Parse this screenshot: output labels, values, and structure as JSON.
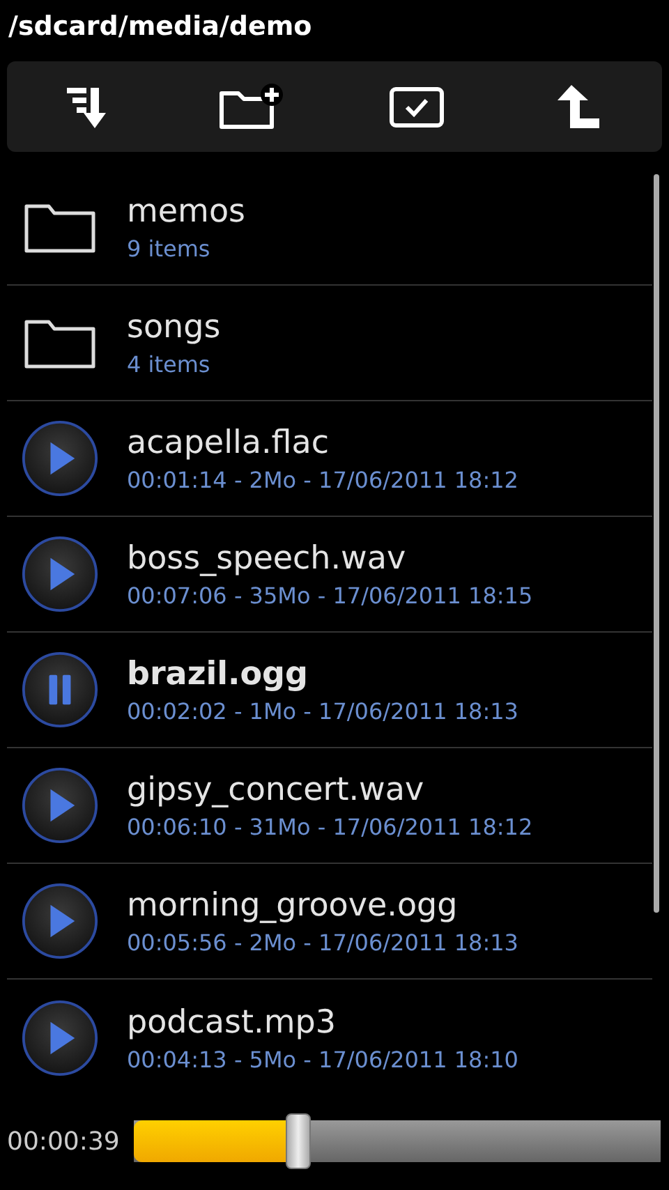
{
  "path": "/sdcard/media/demo",
  "items": [
    {
      "kind": "folder",
      "name": "memos",
      "detail": "9 items"
    },
    {
      "kind": "folder",
      "name": "songs",
      "detail": "4 items"
    },
    {
      "kind": "audio",
      "name": "acapella.flac",
      "detail": "00:01:14 - 2Mo - 17/06/2011 18:12",
      "playing": false
    },
    {
      "kind": "audio",
      "name": "boss_speech.wav",
      "detail": "00:07:06 - 35Mo - 17/06/2011 18:15",
      "playing": false
    },
    {
      "kind": "audio",
      "name": "brazil.ogg",
      "detail": "00:02:02 - 1Mo - 17/06/2011 18:13",
      "playing": true
    },
    {
      "kind": "audio",
      "name": "gipsy_concert.wav",
      "detail": "00:06:10 - 31Mo - 17/06/2011 18:12",
      "playing": false
    },
    {
      "kind": "audio",
      "name": "morning_groove.ogg",
      "detail": "00:05:56 - 2Mo - 17/06/2011 18:13",
      "playing": false
    },
    {
      "kind": "audio",
      "name": "podcast.mp3",
      "detail": "00:04:13 - 5Mo - 17/06/2011 18:10",
      "playing": false
    }
  ],
  "player": {
    "time": "00:00:39",
    "level": 0.32
  }
}
